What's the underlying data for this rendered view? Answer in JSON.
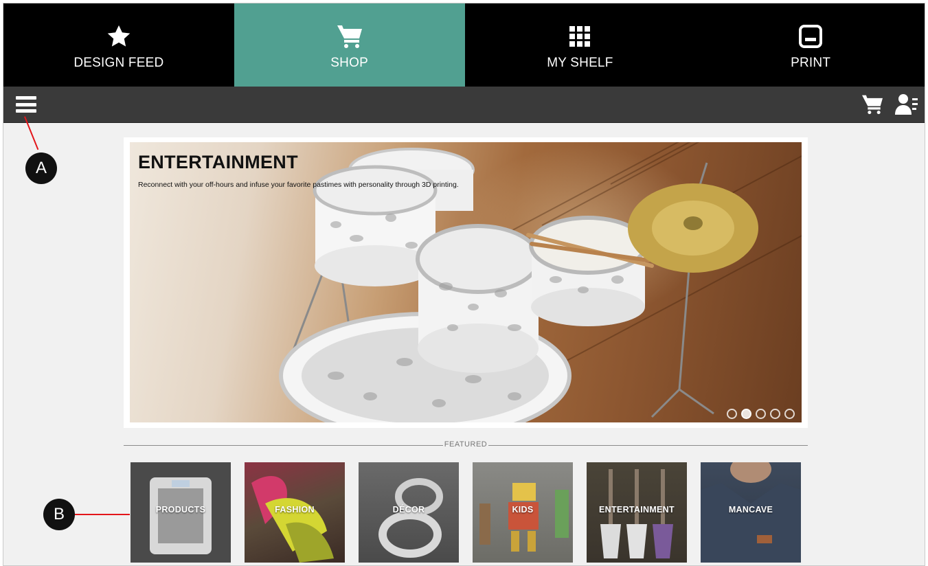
{
  "nav": {
    "items": [
      {
        "label": "DESIGN FEED",
        "icon": "star-icon"
      },
      {
        "label": "SHOP",
        "icon": "cart-icon",
        "active": true
      },
      {
        "label": "MY SHELF",
        "icon": "grid-icon"
      },
      {
        "label": "PRINT",
        "icon": "printer-icon"
      }
    ]
  },
  "toolbar": {
    "menu_icon": "hamburger-menu-icon",
    "cart_icon": "cart-icon",
    "account_icon": "account-icon"
  },
  "hero": {
    "title": "ENTERTAINMENT",
    "subtitle": "Reconnect with your off-hours and infuse your favorite pastimes with personality through 3D printing.",
    "slides": 5,
    "active_slide": 2
  },
  "featured": {
    "label": "FEATURED",
    "tiles": [
      {
        "label": "PRODUCTS"
      },
      {
        "label": "FASHION"
      },
      {
        "label": "DÉCOR"
      },
      {
        "label": "KIDS"
      },
      {
        "label": "ENTERTAINMENT"
      },
      {
        "label": "MANCAVE"
      }
    ]
  },
  "callouts": {
    "a": "A",
    "b": "B"
  },
  "colors": {
    "nav_bg": "#000000",
    "nav_active": "#51a091",
    "toolbar_bg": "#3a3a3a",
    "page_bg": "#f1f1f1",
    "callout_line": "#e3151a"
  }
}
